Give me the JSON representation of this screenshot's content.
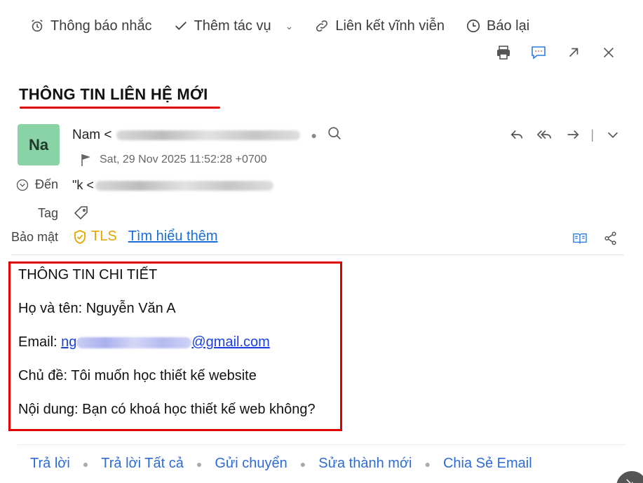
{
  "toolbar": {
    "remind_label": "Thông báo nhắc",
    "add_task_label": "Thêm tác vụ",
    "permalink_label": "Liên kết vĩnh viễn",
    "snooze_label": "Báo lại"
  },
  "actions": [
    "print-icon",
    "comment-icon",
    "popout-icon",
    "close-icon"
  ],
  "message": {
    "subject": "THÔNG TIN LIÊN HỆ MỚI",
    "avatar_initials": "Na",
    "avatar_color": "#8ad3a6",
    "sender_name": "Nam <",
    "date": "Sat, 29 Nov 2025 11:52:28 +0700",
    "to_label": "Đến",
    "to_value": "\"k <",
    "tag_label": "Tag",
    "security_label": "Bảo mật",
    "security_value": "TLS",
    "learn_more": "Tìm hiểu thêm"
  },
  "body": {
    "heading": "THÔNG TIN CHI TIẾT",
    "name_line": "Họ và tên: Nguyễn Văn A",
    "email_prefix": "Email: ",
    "email_link_start": "ng",
    "email_link_end": "@gmail.com",
    "subject_line": "Chủ đề: Tôi muốn học thiết kế website",
    "content_line": "Nội dung: Bạn có khoá học thiết kế web không?"
  },
  "footer": {
    "reply": "Trả lời",
    "reply_all": "Trả lời Tất cả",
    "forward": "Gửi chuyển",
    "edit_as_new": "Sửa thành mới",
    "share": "Chia Sẻ Email"
  },
  "colors": {
    "accent_red": "#e00000",
    "link_blue": "#2d6bd6",
    "tls_yellow": "#e8a400"
  }
}
